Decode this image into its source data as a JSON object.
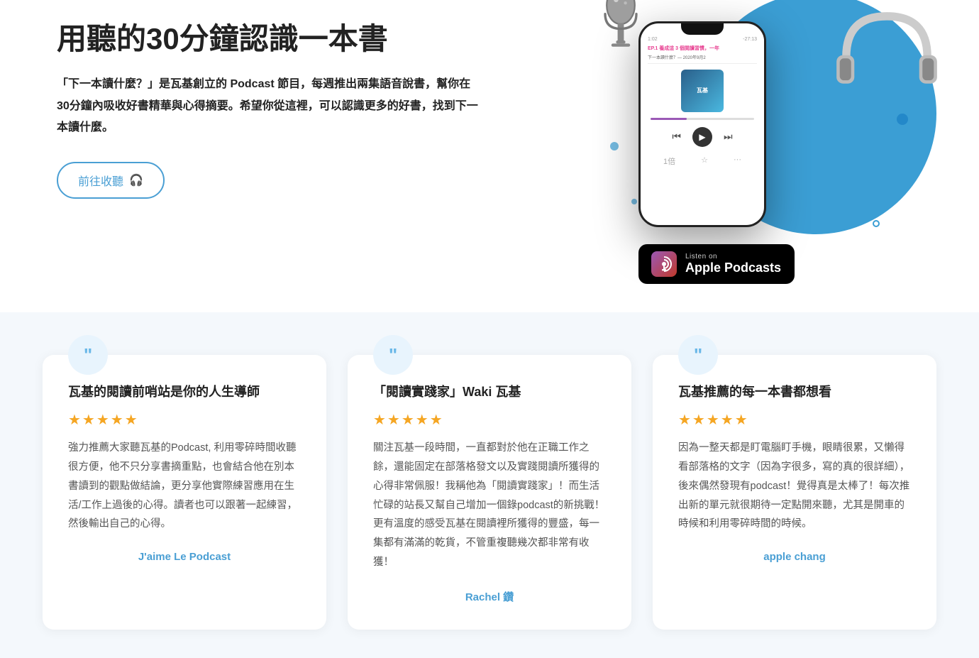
{
  "hero": {
    "title": "用聽的30分鐘認識一本書",
    "desc_prefix": "「下一本讀什麼？」",
    "desc_body": "是瓦基創立的 Podcast 節目，每週推出兩集語音說書，幫你在30分鐘內吸收好書精華與心得摘要。希望你從這裡，可以認識更多的好書，找到下一本讀什麼。",
    "btn_label": "前往收聽",
    "btn_icon": "🎧",
    "phone": {
      "time_left": "1:02",
      "time_right": "-27:13",
      "episode_title": "EP.1 養成這 3 個閱讀習慣，一年",
      "episode_sub": "下一本讀什麼？— 2020年9月2",
      "album_text": "瓦基"
    },
    "apple_badge": {
      "listen_on": "Listen on",
      "name": "Apple Podcasts"
    }
  },
  "testimonials": [
    {
      "quote_char": "\"",
      "title": "瓦基的閱讀前哨站是你的人生導師",
      "stars": "★★★★★",
      "body": "強力推薦大家聽瓦基的Podcast, 利用零碎時間收聽很方便，他不只分享書摘重點，也會結合他在別本書讀到的觀點做結論，更分享他實際練習應用在生活/工作上過後的心得。讀者也可以跟著一起練習，然後輸出自己的心得。",
      "author": "J'aime Le Podcast"
    },
    {
      "quote_char": "\"",
      "title": "「閱讀實踐家」Waki 瓦基",
      "stars": "★★★★★",
      "body": "關注瓦基一段時間，一直都對於他在正職工作之餘，還能固定在部落格發文以及實踐閱讀所獲得的心得非常佩服！我稱他為「閱讀實踐家」！而生活忙碌的站長又幫自己增加一個錄podcast的新挑戰！更有溫度的感受瓦基在閱讀裡所獲得的豐盛，每一集都有滿滿的乾貨，不管重複聽幾次都非常有收獲！",
      "author": "Rachel 鑽"
    },
    {
      "quote_char": "\"",
      "title": "瓦基推薦的每一本書都想看",
      "stars": "★★★★★",
      "body": "因為一整天都是盯電腦盯手機，眼睛很累，又懶得看部落格的文字（因為字很多，寫的真的很詳細），後來偶然發現有podcast！覺得真是太棒了！每次推出新的單元就很期待一定點開來聽，尤其是開車的時候和利用零碎時間的時候。",
      "author": "apple chang"
    }
  ]
}
